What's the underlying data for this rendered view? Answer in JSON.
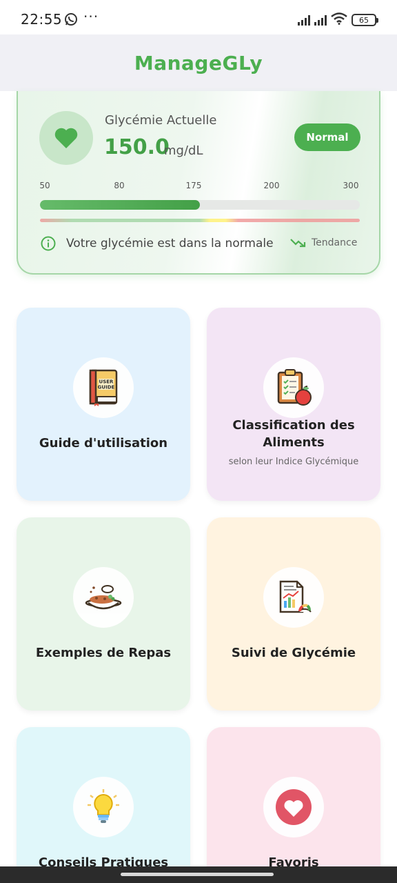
{
  "status_bar": {
    "time": "22:55",
    "battery": "65"
  },
  "app": {
    "title": "ManageGLy"
  },
  "glucose": {
    "label": "Glycémie Actuelle",
    "value": "150.0",
    "unit": "mg/dL",
    "status": "Normal",
    "scale": [
      "50",
      "80",
      "175",
      "200",
      "300"
    ],
    "level_fraction": 0.5,
    "message": "Votre glycémie est dans la normale",
    "trend_label": "Tendance"
  },
  "tiles": [
    {
      "title": "Guide d'utilisation",
      "subtitle": "",
      "icon": "user-guide-book-icon",
      "bg": "#e3f2fd"
    },
    {
      "title": "Classification des Aliments",
      "subtitle": "selon leur Indice Glycémique",
      "icon": "clipboard-apple-icon",
      "bg": "#f3e5f5"
    },
    {
      "title": "Exemples de Repas",
      "subtitle": "",
      "icon": "meal-bowl-icon",
      "bg": "#e8f5e9"
    },
    {
      "title": "Suivi de Glycémie",
      "subtitle": "",
      "icon": "report-chart-icon",
      "bg": "#fff3e0"
    },
    {
      "title": "Conseils Pratiques",
      "subtitle": "",
      "icon": "lightbulb-icon",
      "bg": "#e0f7fa"
    },
    {
      "title": "Favoris",
      "subtitle": "",
      "icon": "heart-favorite-icon",
      "bg": "#fce4ec"
    }
  ],
  "colors": {
    "primary": "#4caf50",
    "appbar_bg": "#f0f0f5"
  }
}
